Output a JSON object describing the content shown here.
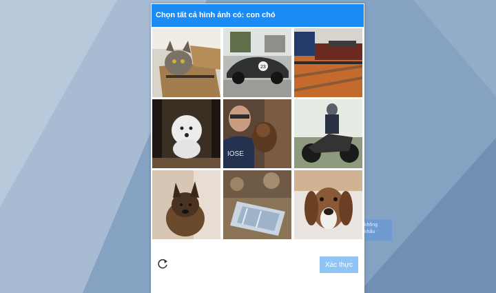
{
  "challenge": {
    "prompt": "Chọn tất cả hình ảnh có: con chó",
    "verify_label": "Xác thực",
    "side_badge_text": "không\nkhẩu",
    "accent_color": "#1b8cf5",
    "tiles": [
      {
        "subject": "cat-in-box"
      },
      {
        "subject": "sports-car"
      },
      {
        "subject": "train"
      },
      {
        "subject": "dog"
      },
      {
        "subject": "man-with-dog"
      },
      {
        "subject": "motorcycle"
      },
      {
        "subject": "dog"
      },
      {
        "subject": "boat"
      },
      {
        "subject": "dog"
      }
    ]
  }
}
